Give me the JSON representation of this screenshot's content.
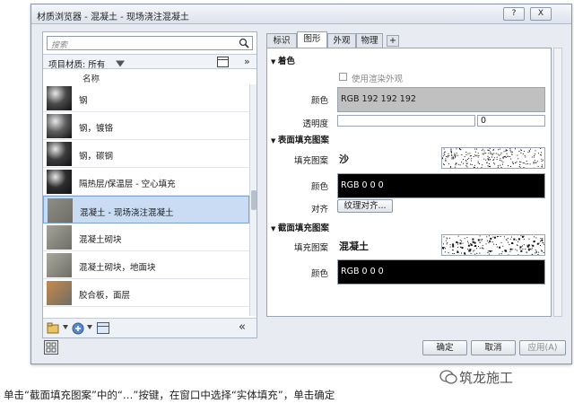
{
  "window": {
    "title": "材质浏览器 - 混凝土 - 现场浇注混凝土",
    "help_label": "?",
    "close_label": "X"
  },
  "left": {
    "search_placeholder": "搜索",
    "library_label": "项目材质: 所有",
    "more_label": "»",
    "column_header": "名称",
    "items": [
      {
        "label": "钢",
        "thumb": "#4a4a4a"
      },
      {
        "label": "钢，镀铬",
        "thumb": "#5e5e5e"
      },
      {
        "label": "钢，碳钢",
        "thumb": "#3c3c3c"
      },
      {
        "label": "隔热层/保温层 - 空心填充",
        "thumb": "#2e2e2e"
      },
      {
        "label": "混凝土 - 现场浇注混凝土",
        "thumb": "#8e8e86"
      },
      {
        "label": "混凝土砌块",
        "thumb": "#a4a39a"
      },
      {
        "label": "混凝土砌块，地面块",
        "thumb": "#a9a89f"
      },
      {
        "label": "胶合板，面层",
        "thumb": "#c8894a"
      }
    ],
    "collapse_label": "«"
  },
  "tabs": [
    {
      "label": "标识"
    },
    {
      "label": "图形"
    },
    {
      "label": "外观"
    },
    {
      "label": "物理"
    },
    {
      "label": "+"
    }
  ],
  "shading": {
    "header": "着色",
    "use_render_label": "使用渲染外观",
    "color_label": "颜色",
    "color_value": "RGB 192 192 192",
    "transparency_label": "透明度",
    "transparency_value": "0"
  },
  "surface": {
    "header": "表面填充图案",
    "pattern_label": "填充图案",
    "pattern_value": "沙",
    "color_label": "颜色",
    "color_value": "RGB 0 0 0",
    "align_label": "对齐",
    "align_button": "纹理对齐..."
  },
  "cut": {
    "header": "截面填充图案",
    "pattern_label": "填充图案",
    "pattern_value": "混凝土",
    "color_label": "颜色",
    "color_value": "RGB 0 0 0"
  },
  "buttons": {
    "ok": "确定",
    "cancel": "取消",
    "apply": "应用(A)"
  },
  "caption": "单击“截面填充图案”中的“…”按键，在窗口中选择“实体填充”，单击确定",
  "watermark": "筑龙施工",
  "colors": {
    "selected_row": "#c9dcf4",
    "swatch_grey": "#c0c0c0",
    "swatch_black": "#000000"
  }
}
